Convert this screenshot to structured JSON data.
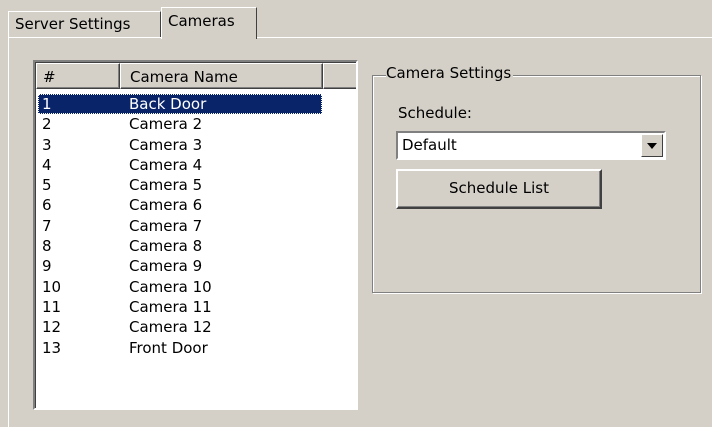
{
  "tabs": [
    {
      "label": "Server Settings",
      "active": false
    },
    {
      "label": "Cameras",
      "active": true
    }
  ],
  "camera_list": {
    "columns": [
      "#",
      "Camera Name"
    ],
    "rows": [
      {
        "num": "1",
        "name": "Back Door",
        "selected": true
      },
      {
        "num": "2",
        "name": "Camera 2"
      },
      {
        "num": "3",
        "name": "Camera 3"
      },
      {
        "num": "4",
        "name": "Camera 4"
      },
      {
        "num": "5",
        "name": "Camera 5"
      },
      {
        "num": "6",
        "name": "Camera 6"
      },
      {
        "num": "7",
        "name": "Camera 7"
      },
      {
        "num": "8",
        "name": "Camera 8"
      },
      {
        "num": "9",
        "name": "Camera 9"
      },
      {
        "num": "10",
        "name": "Camera 10"
      },
      {
        "num": "11",
        "name": "Camera 11"
      },
      {
        "num": "12",
        "name": "Camera 12"
      },
      {
        "num": "13",
        "name": "Front Door"
      }
    ]
  },
  "camera_settings": {
    "title": "Camera Settings",
    "schedule_label": "Schedule:",
    "schedule_value": "Default",
    "schedule_list_button": "Schedule List"
  },
  "icons": {
    "dropdown": "dropdown-arrow-icon"
  },
  "colors": {
    "selection": "#0a246a",
    "face": "#d4d0c8"
  }
}
